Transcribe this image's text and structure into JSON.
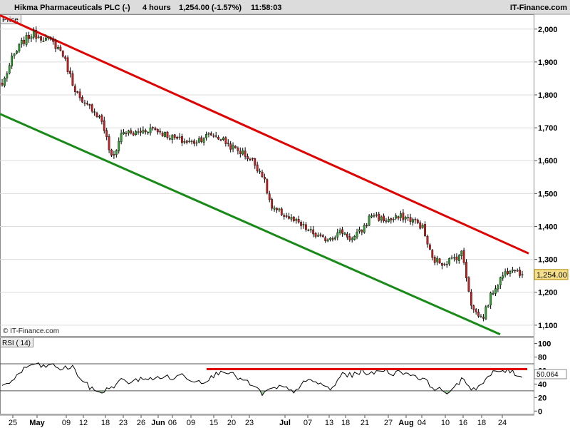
{
  "header": {
    "instrument": "Hikma Pharmaceuticals PLC (-)",
    "timeframe": "4 hours",
    "last_quote": "1,254.00 (-1.57%)",
    "time": "11:58:03",
    "brand": "IT-Finance.com"
  },
  "price_panel": {
    "label": "Price",
    "watermark": "© IT-Finance.com"
  },
  "rsi_panel": {
    "label": "RSI ( 14)",
    "current_value_label": "50.064"
  },
  "chart_data": [
    {
      "type": "candlestick",
      "title": "Hikma Pharmaceuticals PLC (-)",
      "y_ticks": [
        2000,
        1900,
        1800,
        1700,
        1600,
        1500,
        1400,
        1300,
        1200,
        1100
      ],
      "y_tick_labels": [
        "2,000",
        "1,900",
        "1,800",
        "1,700",
        "1,600",
        "1,500",
        "1,400",
        "1,300",
        "1,200",
        "1,100"
      ],
      "ylim": [
        1065,
        2045
      ],
      "last_price": 1254,
      "last_price_label": "1,254.00",
      "x_tick_labels": [
        {
          "label": "25",
          "bold": false
        },
        {
          "label": "May",
          "bold": true
        },
        {
          "label": "09",
          "bold": false
        },
        {
          "label": "12",
          "bold": false
        },
        {
          "label": "18",
          "bold": false
        },
        {
          "label": "23",
          "bold": false
        },
        {
          "label": "26",
          "bold": false
        },
        {
          "label": "Jun",
          "bold": true
        },
        {
          "label": "06",
          "bold": false
        },
        {
          "label": "09",
          "bold": false
        },
        {
          "label": "15",
          "bold": false
        },
        {
          "label": "20",
          "bold": false
        },
        {
          "label": "23",
          "bold": false
        },
        {
          "label": "Jul",
          "bold": true
        },
        {
          "label": "07",
          "bold": false
        },
        {
          "label": "13",
          "bold": false
        },
        {
          "label": "18",
          "bold": false
        },
        {
          "label": "21",
          "bold": false
        },
        {
          "label": "27",
          "bold": false
        },
        {
          "label": "Aug",
          "bold": true
        },
        {
          "label": "04",
          "bold": false
        },
        {
          "label": "10",
          "bold": false
        },
        {
          "label": "16",
          "bold": false
        },
        {
          "label": "18",
          "bold": false
        },
        {
          "label": "24",
          "bold": false
        }
      ],
      "close_path": [
        1830,
        1910,
        1960,
        1985,
        1975,
        1960,
        1930,
        1840,
        1770,
        1760,
        1720,
        1600,
        1690,
        1680,
        1690,
        1700,
        1685,
        1670,
        1660,
        1655,
        1670,
        1680,
        1665,
        1640,
        1625,
        1600,
        1560,
        1450,
        1440,
        1420,
        1400,
        1380,
        1360,
        1370,
        1385,
        1360,
        1390,
        1440,
        1420,
        1420,
        1430,
        1420,
        1400,
        1300,
        1290,
        1300,
        1320,
        1150,
        1120,
        1200,
        1250,
        1280,
        1254
      ],
      "trendlines": [
        {
          "color": "#e00000",
          "from": [
            "start",
            2042
          ],
          "to": [
            "end",
            1318
          ]
        },
        {
          "color": "#178a17",
          "from": [
            "start",
            1742
          ],
          "to": [
            "end",
            1072
          ]
        }
      ]
    },
    {
      "type": "line",
      "title": "RSI ( 14)",
      "y_ticks": [
        0,
        20,
        40,
        60,
        80,
        100
      ],
      "ylim": [
        -5,
        108
      ],
      "reference_lines": [
        30,
        70
      ],
      "last_value": 50.064,
      "values": [
        38,
        45,
        60,
        70,
        66,
        68,
        62,
        66,
        45,
        32,
        28,
        36,
        46,
        42,
        50,
        46,
        52,
        48,
        54,
        46,
        44,
        50,
        62,
        54,
        46,
        38,
        26,
        32,
        36,
        28,
        40,
        46,
        38,
        32,
        56,
        52,
        60,
        54,
        62,
        56,
        58,
        54,
        48,
        36,
        30,
        28,
        50,
        32,
        40,
        56,
        60,
        58,
        50
      ],
      "resistance": {
        "color": "#e00000",
        "value": 62
      }
    }
  ]
}
